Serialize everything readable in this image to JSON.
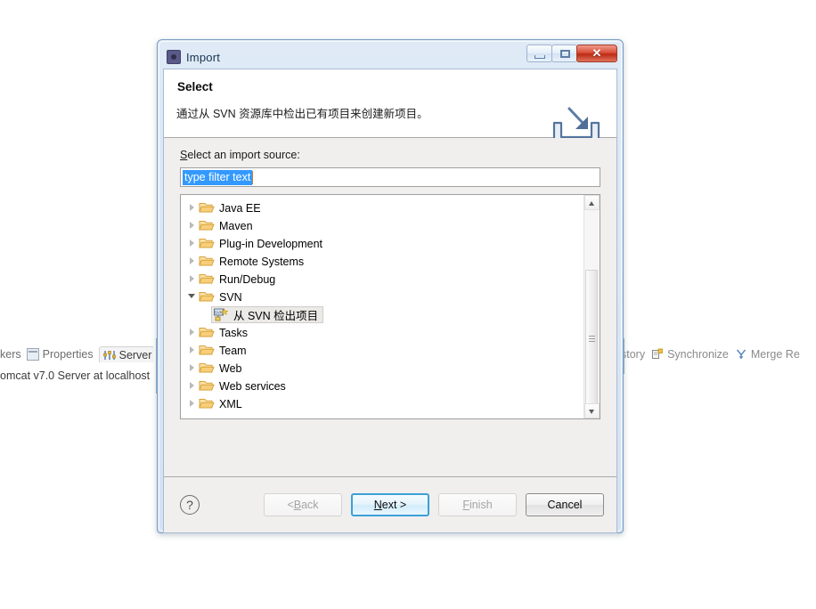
{
  "background": {
    "left_tabs": [
      {
        "label": "kers",
        "icon": "markers-icon",
        "active": false
      },
      {
        "label": "Properties",
        "icon": "properties-icon",
        "active": false
      },
      {
        "label": "Server",
        "icon": "servers-icon",
        "active": true
      }
    ],
    "left_row_text": "omcat v7.0 Server at localhost",
    "right_tabs": [
      {
        "label": "story",
        "icon": "history-icon"
      },
      {
        "label": "Synchronize",
        "icon": "synchronize-icon"
      },
      {
        "label": "Merge Re",
        "icon": "merge-icon"
      }
    ]
  },
  "dialog": {
    "title": "Import",
    "title_icon": "import-app-icon",
    "window_buttons": {
      "minimize": "minimize-icon",
      "maximize": "maximize-icon",
      "close": "✕"
    },
    "header": {
      "title": "Select",
      "description": "通过从 SVN 资源库中检出已有项目来创建新项目。",
      "icon": "import-wizard-icon"
    },
    "form": {
      "source_label_prefix": "S",
      "source_label_rest": "elect an import source:",
      "filter_value": "type filter text",
      "filter_selected": true
    },
    "tree": {
      "items": [
        {
          "label": "Java EE",
          "icon": "folder-icon",
          "expanded": false,
          "level": 0,
          "selected": false
        },
        {
          "label": "Maven",
          "icon": "folder-icon",
          "expanded": false,
          "level": 0,
          "selected": false
        },
        {
          "label": "Plug-in Development",
          "icon": "folder-icon",
          "expanded": false,
          "level": 0,
          "selected": false
        },
        {
          "label": "Remote Systems",
          "icon": "folder-icon",
          "expanded": false,
          "level": 0,
          "selected": false
        },
        {
          "label": "Run/Debug",
          "icon": "folder-icon",
          "expanded": false,
          "level": 0,
          "selected": false
        },
        {
          "label": "SVN",
          "icon": "folder-icon",
          "expanded": true,
          "level": 0,
          "selected": false
        },
        {
          "label": "从 SVN 检出项目",
          "icon": "svn-checkout-icon",
          "expanded": null,
          "level": 1,
          "selected": true
        },
        {
          "label": "Tasks",
          "icon": "folder-icon",
          "expanded": false,
          "level": 0,
          "selected": false
        },
        {
          "label": "Team",
          "icon": "folder-icon",
          "expanded": false,
          "level": 0,
          "selected": false
        },
        {
          "label": "Web",
          "icon": "folder-icon",
          "expanded": false,
          "level": 0,
          "selected": false
        },
        {
          "label": "Web services",
          "icon": "folder-icon",
          "expanded": false,
          "level": 0,
          "selected": false
        },
        {
          "label": "XML",
          "icon": "folder-icon",
          "expanded": false,
          "level": 0,
          "selected": false
        }
      ],
      "scrollbar": {
        "up_arrow": "▲",
        "down_arrow": "▼"
      }
    },
    "footer": {
      "help_label": "?",
      "buttons": [
        {
          "name": "back",
          "label": "< Back",
          "mnemonic_prefix": "< ",
          "mnemonic": "B",
          "mnemonic_rest": "ack",
          "state": "disabled"
        },
        {
          "name": "next",
          "label": "Next >",
          "mnemonic_prefix": "",
          "mnemonic": "N",
          "mnemonic_rest": "ext >",
          "state": "default"
        },
        {
          "name": "finish",
          "label": "Finish",
          "mnemonic_prefix": "",
          "mnemonic": "F",
          "mnemonic_rest": "inish",
          "state": "disabled"
        },
        {
          "name": "cancel",
          "label": "Cancel",
          "mnemonic_prefix": "",
          "mnemonic": "",
          "mnemonic_rest": "Cancel",
          "state": "normal"
        }
      ]
    }
  },
  "colors": {
    "dialog_frame": "#7c9fc4",
    "selection_blue": "#3399ff",
    "default_button_border": "#3c9fd6",
    "close_red": "#bc2a14",
    "folder_yellow": "#f0c061",
    "body_gray": "#f0efee"
  }
}
